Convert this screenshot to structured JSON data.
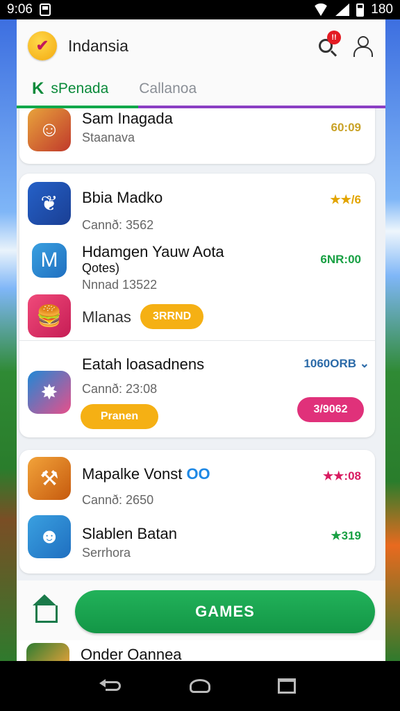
{
  "status_bar": {
    "time": "9:06",
    "battery": "180"
  },
  "header": {
    "title": "Indansia",
    "notification_count": "!!"
  },
  "tabs": [
    {
      "label": "sPenada",
      "mark": "K"
    },
    {
      "label": "Callanoa"
    }
  ],
  "list": {
    "row1": {
      "title": "Sam Inagada",
      "subtitle": "Staanava",
      "meta": "60:09",
      "meta_color": "#c9a227"
    },
    "row2": {
      "title": "Bbia Madko",
      "subtitle": "Cannð: 3562",
      "meta": "★★/6",
      "meta_color": "#e2a400"
    },
    "row3": {
      "title": "Hdamgen Yauw Aota",
      "title2": "Qotes)",
      "subtitle": "Nnnad 13522",
      "meta": "6NR:00",
      "meta_color": "#18a043"
    },
    "row4": {
      "title": "Mlanas",
      "pill": "3RRND",
      "pill_color": "#f5b014"
    },
    "row5": {
      "title": "Eatah loasadnens",
      "subtitle": "Cannð: 23:08",
      "meta": "1060ORB ⌄",
      "meta_color": "#2b6aa8",
      "pill_left": "Pranen",
      "pill_left_color": "#f5b014",
      "pill_right": "3/9062",
      "pill_right_color": "#e0317a"
    },
    "row6": {
      "title": "Mapalke Vonst",
      "title_accent": "OO",
      "subtitle": "Cannð: 2650",
      "meta": "★★:08",
      "meta_color": "#d81b60"
    },
    "row7": {
      "title": "Slablen Batan",
      "subtitle": "Serrhora",
      "meta": "★319",
      "meta_color": "#18a043"
    }
  },
  "action": {
    "games_label": "GAMES"
  },
  "peek": {
    "title": "Onder Oannea"
  },
  "icons": {
    "app_logo": "checkmark-logo-icon",
    "search": "search-icon",
    "user": "user-icon",
    "home": "home-icon",
    "nav": [
      "back-icon",
      "home-nav-icon",
      "recents-icon"
    ]
  }
}
